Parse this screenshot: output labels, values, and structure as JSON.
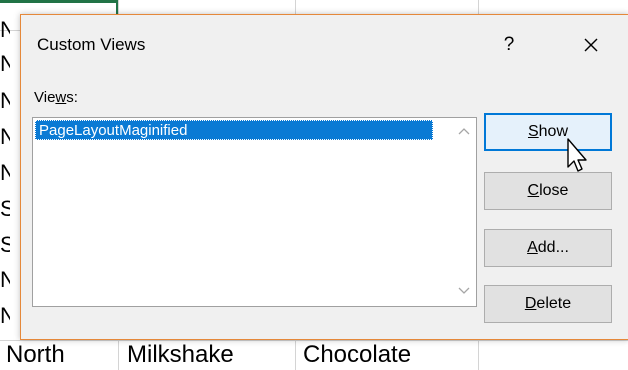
{
  "sheet": {
    "edge_letters": [
      "N",
      "N",
      "N",
      "N",
      "N",
      "S",
      "S",
      "N",
      "N"
    ],
    "visible_row": [
      "North",
      "Milkshake",
      "Chocolate"
    ]
  },
  "dialog": {
    "title": "Custom Views",
    "help": "?",
    "views_label_pre": "Vie",
    "views_label_u": "w",
    "views_label_post": "s:",
    "views": [
      "PageLayoutMaginified"
    ],
    "buttons": {
      "show_u": "S",
      "show_rest": "how",
      "close_u": "C",
      "close_rest": "lose",
      "add_u": "A",
      "add_rest": "dd...",
      "delete_u": "D",
      "delete_rest": "elete"
    }
  },
  "colors": {
    "selection": "#0a7ad4",
    "dialog_border": "#e5883a",
    "default_button_border": "#0078d7",
    "excel_green": "#217346"
  }
}
